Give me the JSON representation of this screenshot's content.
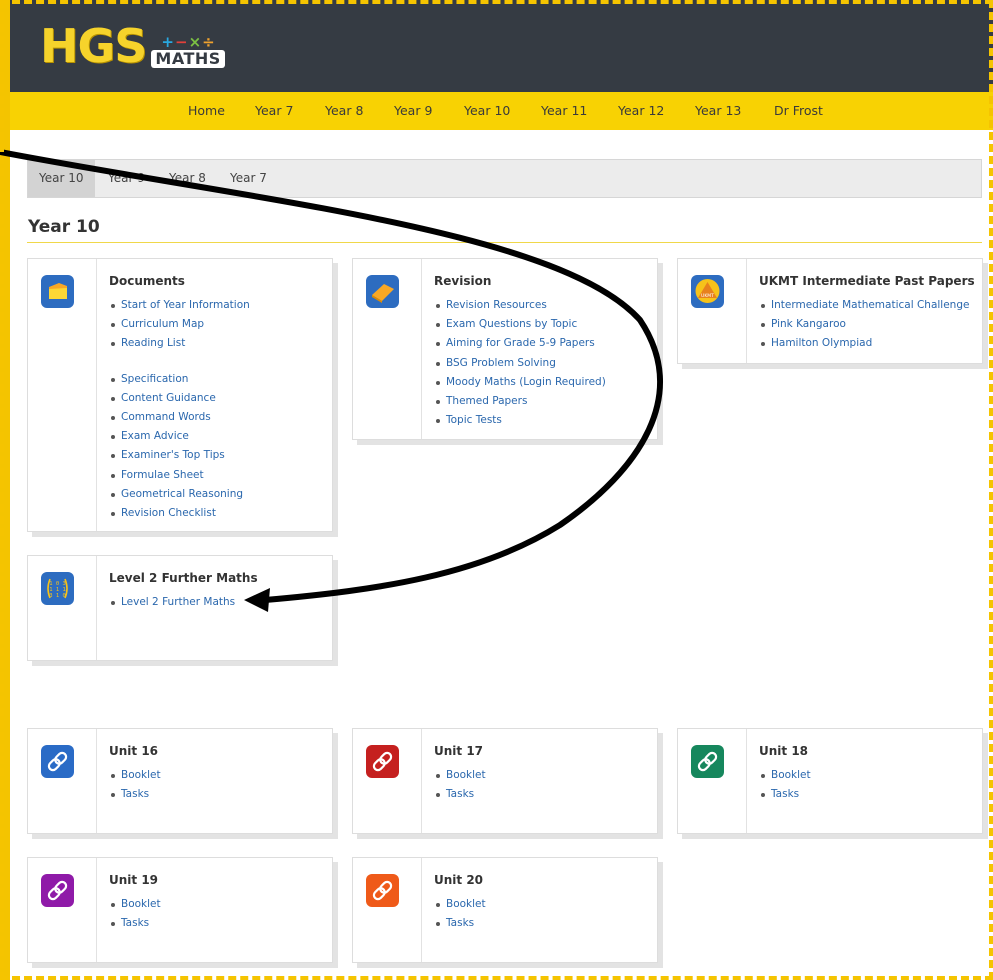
{
  "logo": {
    "hgs": "HGS",
    "ops": [
      "+",
      "−",
      "×",
      "÷"
    ],
    "maths": "MATHS",
    "ops_colors": [
      "#29a8e0",
      "#e2403a",
      "#7cc143",
      "#f0a22e"
    ]
  },
  "nav": {
    "items": [
      "Home",
      "Year 7",
      "Year 8",
      "Year 9",
      "Year 10",
      "Year 11",
      "Year 12",
      "Year 13",
      "Dr Frost"
    ]
  },
  "tabs": {
    "items": [
      "Year 10",
      "Year 9",
      "Year 8",
      "Year 7"
    ],
    "active": "Year 10"
  },
  "page_title": "Year 10",
  "cards": {
    "documents": {
      "title": "Documents",
      "icon": "folder-icon",
      "links": [
        "Start of Year Information",
        "Curriculum Map",
        "Reading List",
        "Specification",
        "Content Guidance",
        "Command Words",
        "Exam Advice",
        "Examiner's Top Tips",
        "Formulae Sheet",
        "Geometrical Reasoning",
        "Revision Checklist"
      ]
    },
    "revision": {
      "title": "Revision",
      "icon": "book-icon",
      "links": [
        "Revision Resources",
        "Exam Questions by Topic",
        "Aiming for Grade 5-9 Papers",
        "BSG Problem Solving",
        "Moody Maths (Login Required)",
        "Themed Papers",
        "Topic Tests"
      ]
    },
    "ukmt": {
      "title": "UKMT Intermediate Past Papers",
      "icon": "ukmt-logo-icon",
      "icon_text": "UKMT",
      "links": [
        "Intermediate Mathematical Challenge",
        "Pink Kangaroo",
        "Hamilton Olympiad"
      ]
    },
    "further": {
      "title": "Level 2 Further Maths",
      "icon": "matrix-icon",
      "matrix": [
        "1 0 3",
        "1 1 1",
        "3 1 0"
      ],
      "links": [
        "Level 2 Further Maths"
      ]
    },
    "unit16": {
      "title": "Unit 16",
      "icon": "link-icon",
      "color": "#2a6bc6",
      "links": [
        "Booklet",
        "Tasks"
      ]
    },
    "unit17": {
      "title": "Unit 17",
      "icon": "link-icon",
      "color": "#c5201f",
      "links": [
        "Booklet",
        "Tasks"
      ]
    },
    "unit18": {
      "title": "Unit 18",
      "icon": "link-icon",
      "color": "#16875d",
      "links": [
        "Booklet",
        "Tasks"
      ]
    },
    "unit19": {
      "title": "Unit 19",
      "icon": "link-icon",
      "color": "#8f1aa8",
      "links": [
        "Booklet",
        "Tasks"
      ]
    },
    "unit20": {
      "title": "Unit 20",
      "icon": "link-icon",
      "color": "#ef5a19",
      "links": [
        "Booklet",
        "Tasks"
      ]
    }
  },
  "colors": {
    "header_bg": "#353b43",
    "nav_bg": "#f8d203",
    "logo_yellow": "#f6d32b",
    "link": "#2a67ad",
    "icon_blue": "#2d6cc0"
  }
}
